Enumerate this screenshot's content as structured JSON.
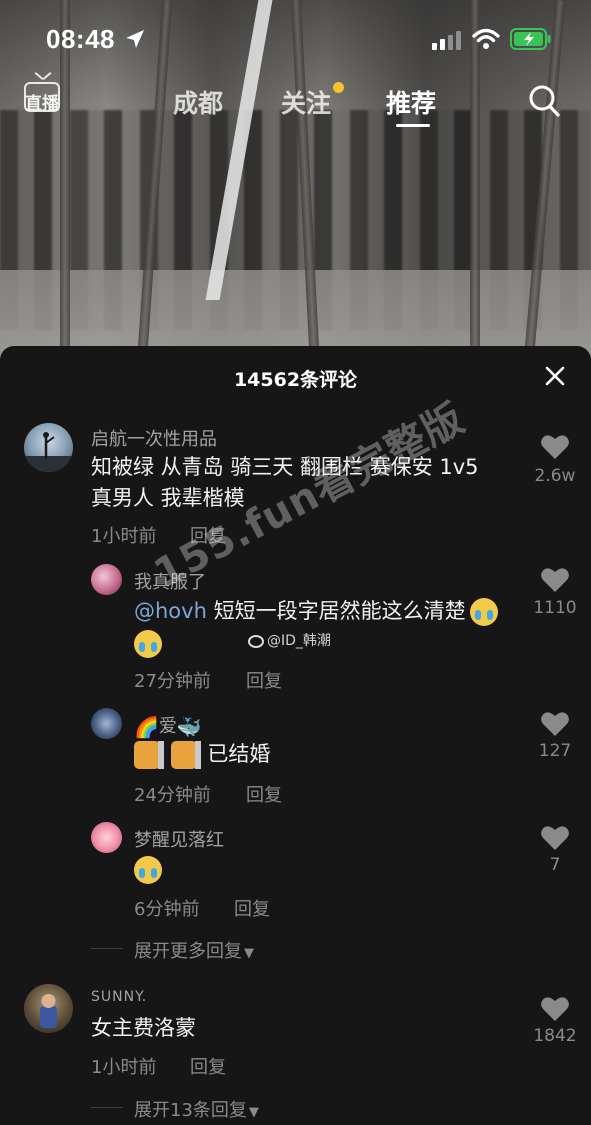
{
  "status_bar": {
    "time": "08:48"
  },
  "nav": {
    "live_label": "直播",
    "tabs": [
      {
        "label": "成都"
      },
      {
        "label": "关注"
      },
      {
        "label": "推荐"
      }
    ],
    "active_tab": "推荐"
  },
  "sheet": {
    "title": "14562条评论",
    "comments": [
      {
        "username": "启航一次性用品",
        "lines": [
          "知被绿 从青岛 骑三天 翻围栏 赛保安 1v5",
          "真男人 我辈楷模"
        ],
        "time": "1小时前",
        "reply": "回复",
        "likes": "2.6w",
        "replies": [
          {
            "username": "我真服了",
            "mention": "@hovh",
            "text": "短短一段字居然能这么清楚",
            "time": "27分钟前",
            "reply": "回复",
            "likes": "1110"
          },
          {
            "username": "爱",
            "text": "已结婚",
            "time": "24分钟前",
            "reply": "回复",
            "likes": "127"
          },
          {
            "username": "梦醒见落红",
            "text": "",
            "time": "6分钟前",
            "reply": "回复",
            "likes": "7"
          }
        ],
        "expand": "展开更多回复"
      },
      {
        "username": "SUNNY.",
        "lines": [
          "女主费洛蒙"
        ],
        "time": "1小时前",
        "reply": "回复",
        "likes": "1842",
        "expand": "展开13条回复"
      }
    ]
  },
  "watermarks": {
    "site": "155.fun看完整版",
    "weibo": "@ID_韩潮"
  },
  "colors": {
    "background": "#161616",
    "notify_dot": "#f6c22d",
    "mention": "#7ea7d6"
  },
  "icons": [
    "location-arrow-icon",
    "signal-icon",
    "wifi-icon",
    "battery-icon",
    "live-tv-icon",
    "search-icon",
    "close-icon",
    "heart-icon",
    "chevron-down-icon",
    "weibo-icon"
  ]
}
